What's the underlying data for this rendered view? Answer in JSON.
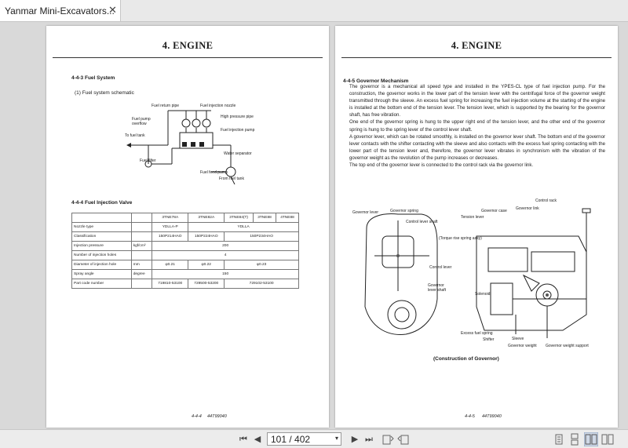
{
  "tab": {
    "title": "Yanmar Mini-Excavators...",
    "close": "✕"
  },
  "left_page": {
    "header": "4. ENGINE",
    "sec1": "4-4-3 Fuel System",
    "sub1": "(1) Fuel system schematic",
    "schematic_labels": {
      "return_pipe": "Fuel return pipe",
      "nozzle": "Fuel injection nozzle",
      "hp_pipe": "High pressure pipe",
      "overflow1": "Fuel pump",
      "overflow2": "overflow",
      "inj_pump": "Fuel injection pump",
      "to_tank": "To fuel tank",
      "separator": "Water separator",
      "filter": "Fuel filter",
      "feed_pump": "Fuel feed pump",
      "from_tank": "From fuel tank"
    },
    "sec2": "4-4-4 Fuel Injection Valve",
    "table": {
      "headers": [
        "",
        "",
        "3TNE78A",
        "3TNE82A",
        "3TNE84(T)",
        "3TNE88",
        "4TNE88"
      ],
      "rows": [
        [
          "Nozzle type",
          "",
          "YDLLA-P",
          "YDLLA"
        ],
        [
          "Classification",
          "",
          "150P214HAO",
          "150P224HAO",
          "150P234HAO"
        ],
        [
          "Injection pressure",
          "kgf/cm²",
          "200"
        ],
        [
          "Number of injection holes",
          "",
          "4"
        ],
        [
          "Diameter of injection hole",
          "mm",
          "φ0.21",
          "φ0.22",
          "φ0.23"
        ],
        [
          "Spray angle",
          "degree",
          "150"
        ],
        [
          "Part code number",
          "",
          "719810-53100",
          "729500-53200",
          "729102-53100"
        ]
      ]
    },
    "footer_page": "4-4-4",
    "footer_code": "44T99040"
  },
  "right_page": {
    "header": "4. ENGINE",
    "sec": "4-4-5 Governor Mechanism",
    "paragraphs": [
      "The governor is a mechanical all speed type and installed in the YPES-CL type of fuel injection pump. For the construction, the governor works in the lower part of the tension lever with the centrifugal force of the governor weight transmitted through the sleeve. An excess fuel spring for increasing the fuel injection volume at the starting of the engine is installed at the bottom end of the tension lever. The tension lever, which is supported by the bearing for the governor shaft, has free vibration.",
      "One end of the governor spring is hung to the upper right end of the tension lever, and the other end of the governor spring is hung to the spring lever of the control lever shaft.",
      "A governor lever, which can be rotated smoothly, is installed on the governor lever shaft. The bottom end of the governor lever contacts with the shifter contacting with the sleeve and also contacts with the excess fuel spring contacting with the lower part of the tension lever and, therefore, the governor lever vibrates in synchronism with the vibration of the governor weight as the revolution of the pump increases or decreases.",
      "The top end of the governor lever is connected to the control rack via the governor link."
    ],
    "diagram_labels": {
      "gov_lever": "Governor lever",
      "gov_spring": "Governor spring",
      "ctrl_shaft": "Control lever shaft",
      "ctrl_lever": "Control lever",
      "gov_lever_shaft1": "Governor",
      "gov_lever_shaft2": "lever shaft",
      "ctrl_rack": "Control rack",
      "gov_case": "Governor case",
      "gov_link": "Governor link",
      "tension": "Tension lever",
      "torque": "(Torque rise spring assy)",
      "solenoid": "Solenoid",
      "excess": "Excess fuel spring",
      "shifter": "Shifter",
      "sleeve": "Sleeve",
      "gov_weight": "Governor weight",
      "weight_support": "Governor weight support"
    },
    "caption": "(Construction of Governor)",
    "footer_page": "4-4-5",
    "footer_code": "44T99040"
  },
  "toolbar": {
    "first": "⏮",
    "prev": "◀",
    "page_value": "101 / 402",
    "dropdown": "▾",
    "next": "▶",
    "last": "⏭"
  }
}
